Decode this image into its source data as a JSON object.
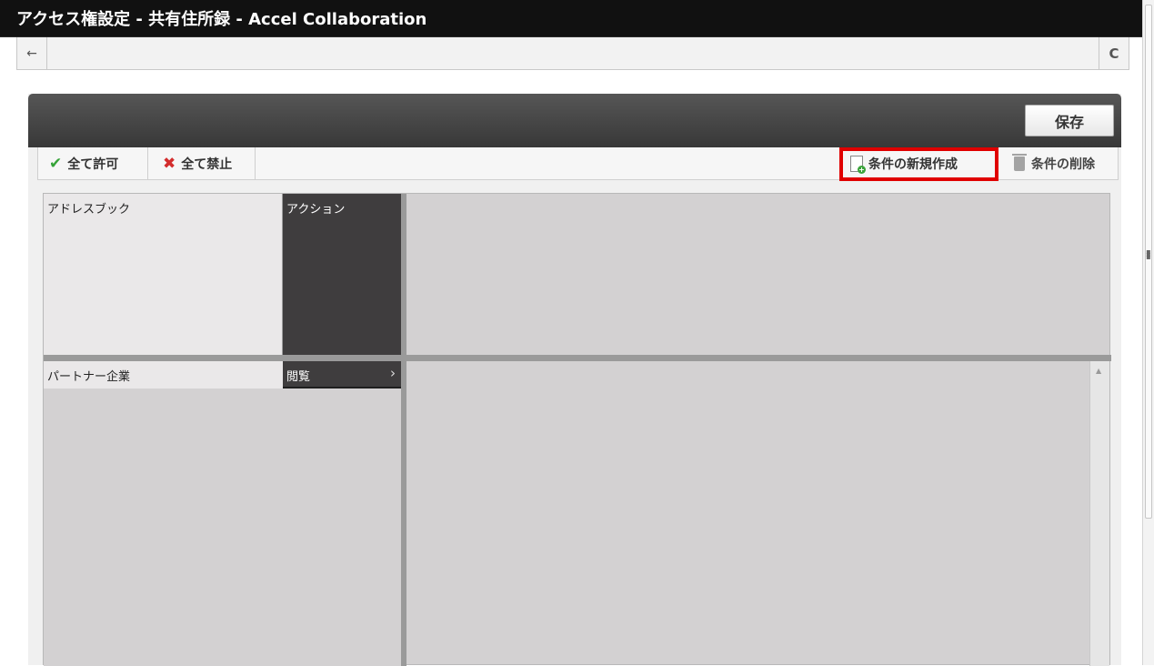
{
  "window": {
    "title": "アクセス権設定 - 共有住所録 - Accel Collaboration"
  },
  "navbar": {
    "back_icon": "←",
    "reload_icon": "C"
  },
  "panel": {
    "save_label": "保存",
    "toolbar": {
      "allow_all_label": "全て許可",
      "deny_all_label": "全て禁止",
      "new_condition_label": "条件の新規作成",
      "delete_condition_label": "条件の削除"
    }
  },
  "matrix": {
    "address_book_header": "アドレスブック",
    "action_header": "アクション",
    "rows": [
      {
        "address_book": "パートナー企業",
        "action": "閲覧"
      }
    ]
  },
  "colors": {
    "highlight": "#e00000",
    "allow_check": "#36a339",
    "deny_x": "#d32d2d",
    "title_bar": "#111111"
  }
}
